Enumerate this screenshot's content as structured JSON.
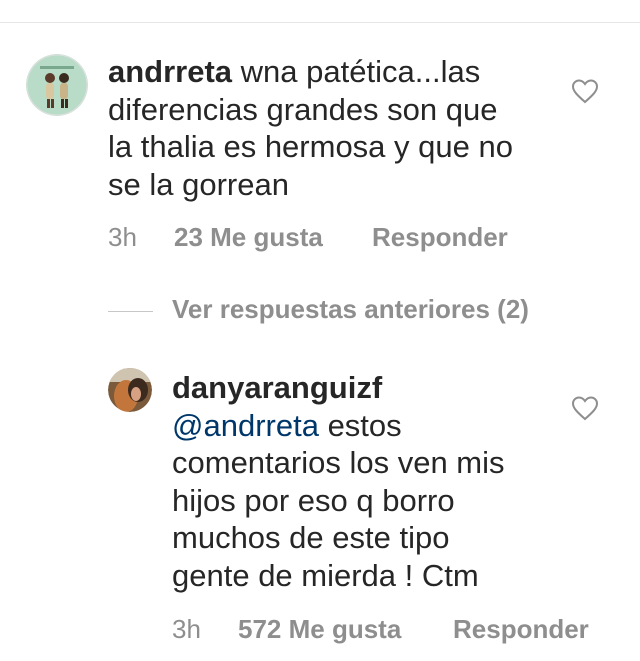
{
  "comments": [
    {
      "username": "andrreta",
      "text_lines": [
        "wna patética...las",
        "diferencias grandes son que",
        "la thalia es hermosa y que no",
        "se la gorrean"
      ],
      "time": "3h",
      "likes": "23 Me gusta",
      "reply_label": "Responder",
      "avatar_icon": "cartoon-couple-avatar"
    },
    {
      "username": "danyaranguizf",
      "mention": "@andrreta",
      "text_lines": [
        "estos",
        "comentarios los ven mis",
        "hijos por eso q borro",
        "muchos de este tipo",
        "gente de mierda ! Ctm"
      ],
      "time": "3h",
      "likes": "572 Me gusta",
      "reply_label": "Responder",
      "avatar_icon": "profile-photo-avatar"
    }
  ],
  "view_previous_replies": "Ver respuestas anteriores (2)",
  "colors": {
    "text": "#262626",
    "secondary": "#8e8e8e",
    "mention": "#00376b",
    "divider": "#e6e6e6"
  }
}
